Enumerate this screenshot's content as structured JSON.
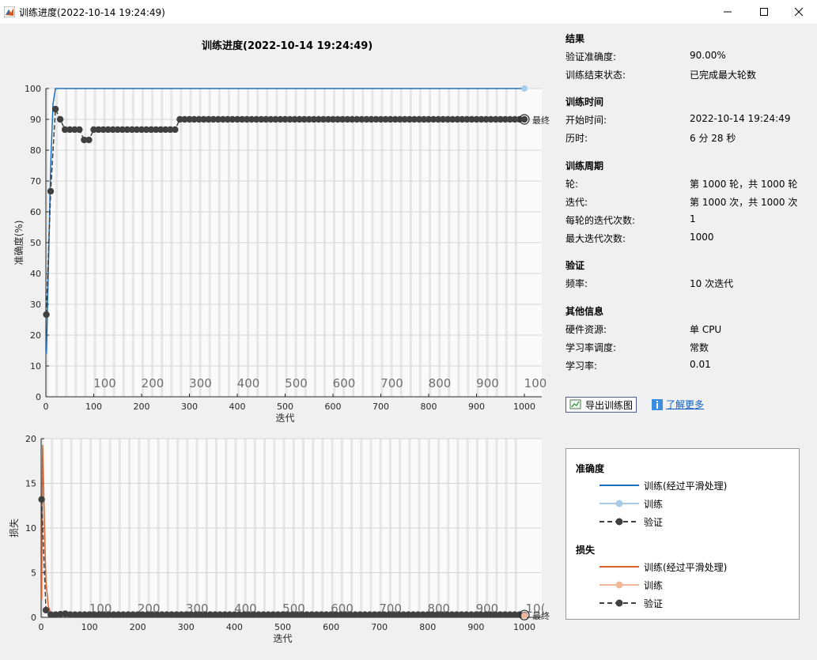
{
  "window": {
    "title": "训练进度(2022-10-14 19:24:49)"
  },
  "panel_title": "训练进度(2022-10-14 19:24:49)",
  "colors": {
    "train_smoothed_acc": "#1a70c0",
    "train_acc": "#a8cbe8",
    "validation": "#404040",
    "train_smoothed_loss": "#e0602a",
    "train_loss": "#f0b89a",
    "grid_band": "#e6e6e6"
  },
  "accuracy_plot": {
    "ylabel": "准确度(%)",
    "xlabel": "迭代",
    "epoch_tick_labels": [
      "100",
      "200",
      "300",
      "400",
      "500",
      "600",
      "700",
      "800",
      "900",
      "100"
    ],
    "final_marker_label": "最终"
  },
  "loss_plot": {
    "ylabel": "损失",
    "xlabel": "迭代",
    "epoch_tick_labels": [
      "100",
      "200",
      "300",
      "400",
      "500",
      "600",
      "700",
      "800",
      "900",
      "10("
    ],
    "final_marker_label": "最终"
  },
  "chart_data": [
    {
      "type": "line",
      "ylabel": "准确度(%)",
      "xlabel": "迭代",
      "xlim": [
        0,
        1000
      ],
      "ylim": [
        0,
        100
      ],
      "xticks": [
        0,
        100,
        200,
        300,
        400,
        500,
        600,
        700,
        800,
        900,
        1000
      ],
      "yticks": [
        0,
        10,
        20,
        30,
        40,
        50,
        60,
        70,
        80,
        90,
        100
      ],
      "grid": true,
      "series": [
        {
          "name": "训练(经过平滑处理)",
          "x": [
            1,
            5,
            10,
            15,
            20,
            30,
            50,
            100,
            1000
          ],
          "y": [
            14,
            40,
            75,
            95,
            100,
            100,
            100,
            100,
            100
          ]
        },
        {
          "name": "训练",
          "x": [
            1000
          ],
          "y": [
            100
          ]
        },
        {
          "name": "验证",
          "x": [
            1,
            10,
            20,
            30,
            40,
            50,
            60,
            70,
            80,
            90,
            100,
            110,
            120,
            130,
            140,
            150,
            160,
            170,
            180,
            190,
            200,
            210,
            220,
            230,
            240,
            250,
            260,
            270,
            280,
            1000
          ],
          "y": [
            26.67,
            66.67,
            93.33,
            90,
            86.67,
            86.67,
            86.67,
            86.67,
            83.33,
            83.33,
            86.67,
            86.67,
            86.67,
            86.67,
            86.67,
            86.67,
            86.67,
            86.67,
            86.67,
            86.67,
            86.67,
            86.67,
            86.67,
            86.67,
            86.67,
            86.67,
            86.67,
            86.67,
            90,
            90
          ]
        }
      ]
    },
    {
      "type": "line",
      "ylabel": "损失",
      "xlabel": "迭代",
      "xlim": [
        0,
        1000
      ],
      "ylim": [
        0,
        20
      ],
      "xticks": [
        0,
        100,
        200,
        300,
        400,
        500,
        600,
        700,
        800,
        900,
        1000
      ],
      "yticks": [
        0,
        5,
        10,
        15,
        20
      ],
      "grid": true,
      "series": [
        {
          "name": "训练(经过平滑处理)",
          "x": [
            1,
            3,
            5,
            8,
            10,
            15,
            20,
            40,
            1000
          ],
          "y": [
            2,
            19.3,
            15,
            8,
            4,
            1.2,
            0.5,
            0.3,
            0.2
          ]
        },
        {
          "name": "训练",
          "x": [
            1000
          ],
          "y": [
            0.2
          ]
        },
        {
          "name": "验证",
          "x": [
            1,
            10,
            20,
            30,
            40,
            50,
            60,
            70,
            80,
            90,
            100,
            1000
          ],
          "y": [
            13.2,
            0.8,
            0.3,
            0.3,
            0.35,
            0.4,
            0.3,
            0.3,
            0.3,
            0.3,
            0.3,
            0.25
          ]
        }
      ]
    }
  ],
  "info": {
    "results_h": "结果",
    "val_acc_l": "验证准确度:",
    "val_acc_v": "90.00%",
    "end_state_l": "训练结束状态:",
    "end_state_v": "已完成最大轮数",
    "time_h": "训练时间",
    "start_l": "开始时间:",
    "start_v": "2022-10-14 19:24:49",
    "elapsed_l": "历时:",
    "elapsed_v": "6 分 28 秒",
    "cycle_h": "训练周期",
    "epoch_l": "轮:",
    "epoch_v": "第 1000 轮，共 1000 轮",
    "iter_l": "迭代:",
    "iter_v": "第 1000 次，共 1000 次",
    "iter_per_epoch_l": "每轮的迭代次数:",
    "iter_per_epoch_v": "1",
    "max_iter_l": "最大迭代次数:",
    "max_iter_v": "1000",
    "validation_h": "验证",
    "freq_l": "频率:",
    "freq_v": "10 次迭代",
    "other_h": "其他信息",
    "hw_l": "硬件资源:",
    "hw_v": "单 CPU",
    "lr_sched_l": "学习率调度:",
    "lr_sched_v": "常数",
    "lr_l": "学习率:",
    "lr_v": "0.01"
  },
  "buttons": {
    "export_label": "导出训练图",
    "learn_more_label": "了解更多"
  },
  "legend": {
    "acc_h": "准确度",
    "acc_smooth": "训练(经过平滑处理)",
    "acc_train": "训练",
    "acc_val": "验证",
    "loss_h": "损失",
    "loss_smooth": "训练(经过平滑处理)",
    "loss_train": "训练",
    "loss_val": "验证"
  }
}
